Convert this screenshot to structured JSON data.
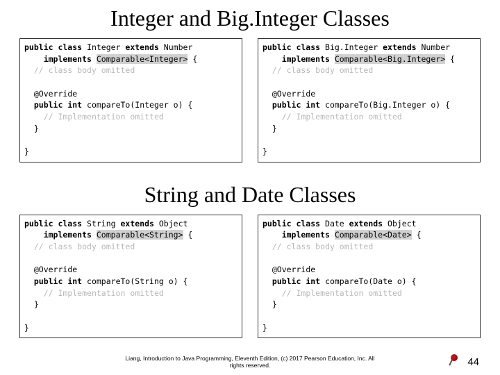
{
  "title1": "Integer and Big.Integer Classes",
  "title2": "String and Date Classes",
  "box_integer": {
    "l1a": "public class ",
    "l1b": "Integer ",
    "l1c": "extends ",
    "l1d": "Number",
    "l2a": "implements ",
    "l2b": "Comparable<Integer>",
    "l2c": " {",
    "l3": "// class body omitted",
    "l5": "@Override",
    "l6a": "public int ",
    "l6b": "compareTo(Integer o) {",
    "l7": "// Implementation omitted",
    "l8": "}",
    "l10": "}"
  },
  "box_biginteger": {
    "l1a": "public class ",
    "l1b": "Big.Integer ",
    "l1c": "extends ",
    "l1d": "Number",
    "l2a": "implements ",
    "l2b": "Comparable<Big.Integer>",
    "l2c": " {",
    "l3": "// class body omitted",
    "l5": "@Override",
    "l6a": "public int ",
    "l6b": "compareTo(Big.Integer o) {",
    "l7": "// Implementation omitted",
    "l8": "}",
    "l10": "}"
  },
  "box_string": {
    "l1a": "public class ",
    "l1b": "String ",
    "l1c": "extends ",
    "l1d": "Object",
    "l2a": "implements ",
    "l2b": "Comparable<String>",
    "l2c": " {",
    "l3": "// class body omitted",
    "l5": "@Override",
    "l6a": "public int ",
    "l6b": "compareTo(String o) {",
    "l7": "// Implementation omitted",
    "l8": "}",
    "l10": "}"
  },
  "box_date": {
    "l1a": "public class ",
    "l1b": "Date ",
    "l1c": "extends ",
    "l1d": "Object",
    "l2a": "implements ",
    "l2b": "Comparable<Date>",
    "l2c": " {",
    "l3": "// class body omitted",
    "l5": "@Override",
    "l6a": "public int ",
    "l6b": "compareTo(Date o) {",
    "l7": "// Implementation omitted",
    "l8": "}",
    "l10": "}"
  },
  "footer_l1": "Liang, Introduction to Java Programming, Eleventh Edition, (c) 2017 Pearson Education, Inc. All",
  "footer_l2": "rights reserved.",
  "pagenum": "44"
}
